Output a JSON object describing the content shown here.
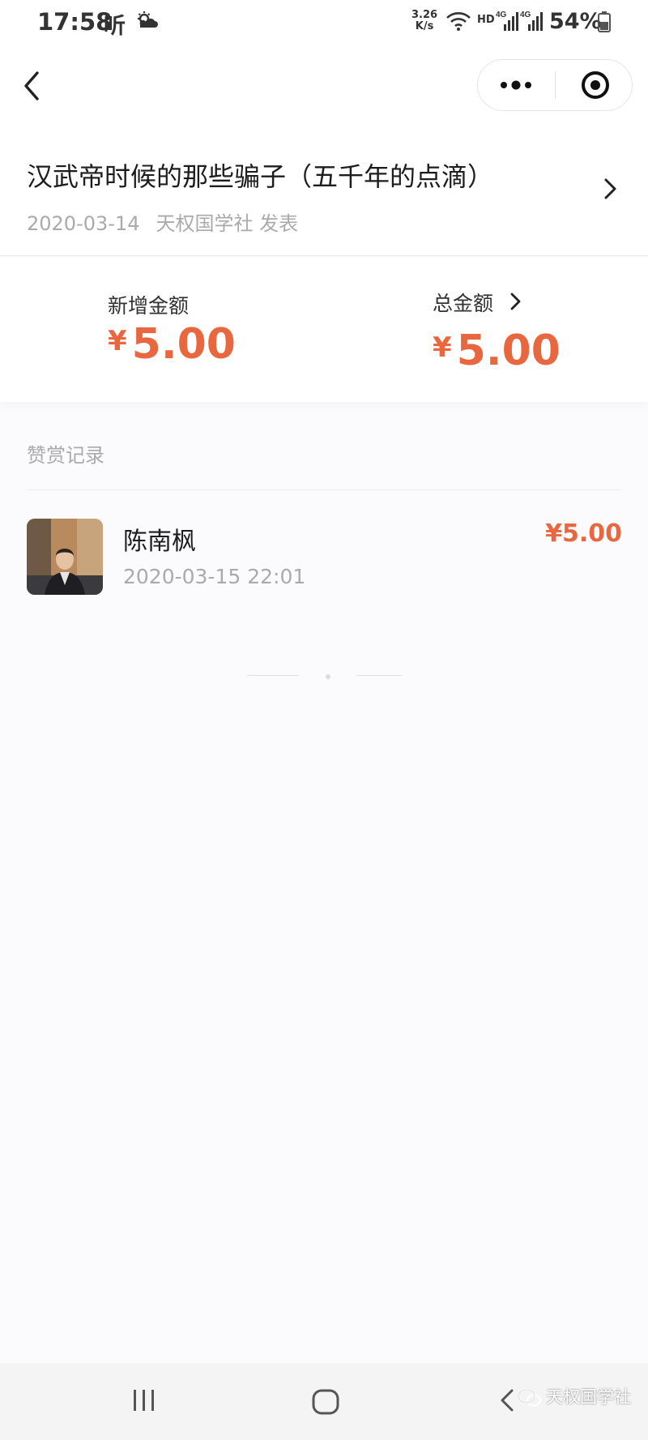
{
  "status_bar": {
    "time": "17:58",
    "ting_label": "听",
    "net_speed_value": "3.26",
    "net_speed_unit": "K/s",
    "hd_label": "HD",
    "signal_1_label": "4G",
    "signal_2_label": "4G",
    "battery": "54%",
    "icons": [
      "weather-sun-cloud-icon",
      "wifi-icon",
      "signal-icon",
      "battery-icon"
    ]
  },
  "nav": {
    "icons": [
      "back-chevron-icon",
      "more-dots-icon",
      "target-circle-icon"
    ]
  },
  "article": {
    "title": "汉武帝时候的那些骗子（五千年的点滴）",
    "date": "2020-03-14",
    "publisher": "天权国学社 发表"
  },
  "amounts": {
    "new_label": "新增金额",
    "new_currency": "¥",
    "new_value": "5.00",
    "total_label": "总金额",
    "total_currency": "¥",
    "total_value": "5.00"
  },
  "records": {
    "title": "赞赏记录",
    "items": [
      {
        "name": "陈南枫",
        "time": "2020-03-15 22:01",
        "amount": "¥5.00"
      }
    ]
  },
  "system_nav": {
    "icons": [
      "recents-icon",
      "home-icon",
      "back-icon"
    ]
  },
  "watermark": {
    "text": "天权国学社"
  },
  "colors": {
    "accent": "#e8673f",
    "muted_text": "#aaaaaa",
    "background": "#fbfbfd"
  }
}
